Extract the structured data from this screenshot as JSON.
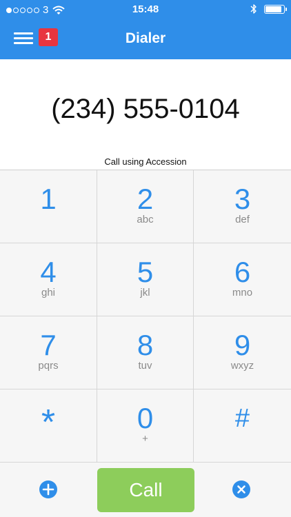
{
  "status_bar": {
    "carrier": "3",
    "signal_bars_filled": 1,
    "signal_bars_total": 5,
    "time": "15:48",
    "battery_level": 0.9
  },
  "nav": {
    "title": "Dialer",
    "badge_count": "1",
    "menu_icon": "hamburger-menu-icon"
  },
  "display": {
    "number": "(234) 555-0104",
    "call_using": "Call using Accession"
  },
  "keypad": {
    "keys": [
      {
        "digit": "1",
        "letters": ""
      },
      {
        "digit": "2",
        "letters": "abc"
      },
      {
        "digit": "3",
        "letters": "def"
      },
      {
        "digit": "4",
        "letters": "ghi"
      },
      {
        "digit": "5",
        "letters": "jkl"
      },
      {
        "digit": "6",
        "letters": "mno"
      },
      {
        "digit": "7",
        "letters": "pqrs"
      },
      {
        "digit": "8",
        "letters": "tuv"
      },
      {
        "digit": "9",
        "letters": "wxyz"
      },
      {
        "digit": "*",
        "letters": ""
      },
      {
        "digit": "0",
        "letters": "+"
      },
      {
        "digit": "#",
        "letters": ""
      }
    ]
  },
  "bottom": {
    "call_label": "Call",
    "add_icon": "add-contact-icon",
    "backspace_icon": "backspace-icon"
  },
  "colors": {
    "brand_blue": "#2f8ee9",
    "call_green": "#8dcd5b",
    "badge_red": "#e8353f"
  }
}
